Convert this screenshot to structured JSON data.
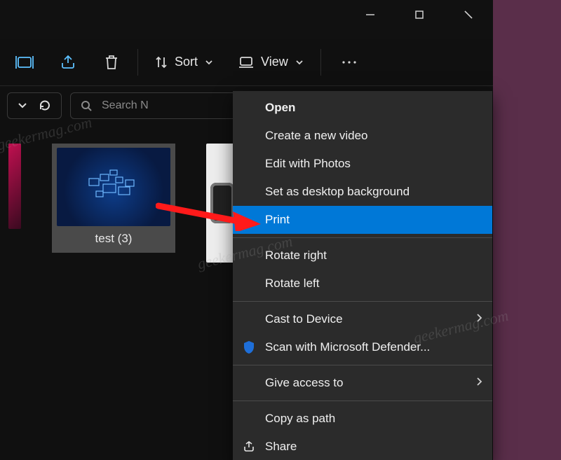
{
  "titlebar": {
    "minimize_tooltip": "Minimize",
    "maximize_tooltip": "Maximize",
    "close_tooltip": "Close"
  },
  "toolbar": {
    "sort_label": "Sort",
    "view_label": "View"
  },
  "subbar": {
    "search_placeholder": "Search N"
  },
  "thumbs": {
    "selected_label": "test (3)"
  },
  "context_menu": {
    "open": "Open",
    "create_video": "Create a new video",
    "edit_photos": "Edit with Photos",
    "set_desktop": "Set as desktop background",
    "print": "Print",
    "rotate_right": "Rotate right",
    "rotate_left": "Rotate left",
    "cast": "Cast to Device",
    "defender": "Scan with Microsoft Defender...",
    "give_access": "Give access to",
    "copy_path": "Copy as path",
    "share": "Share"
  },
  "watermark": "geekermag.com"
}
